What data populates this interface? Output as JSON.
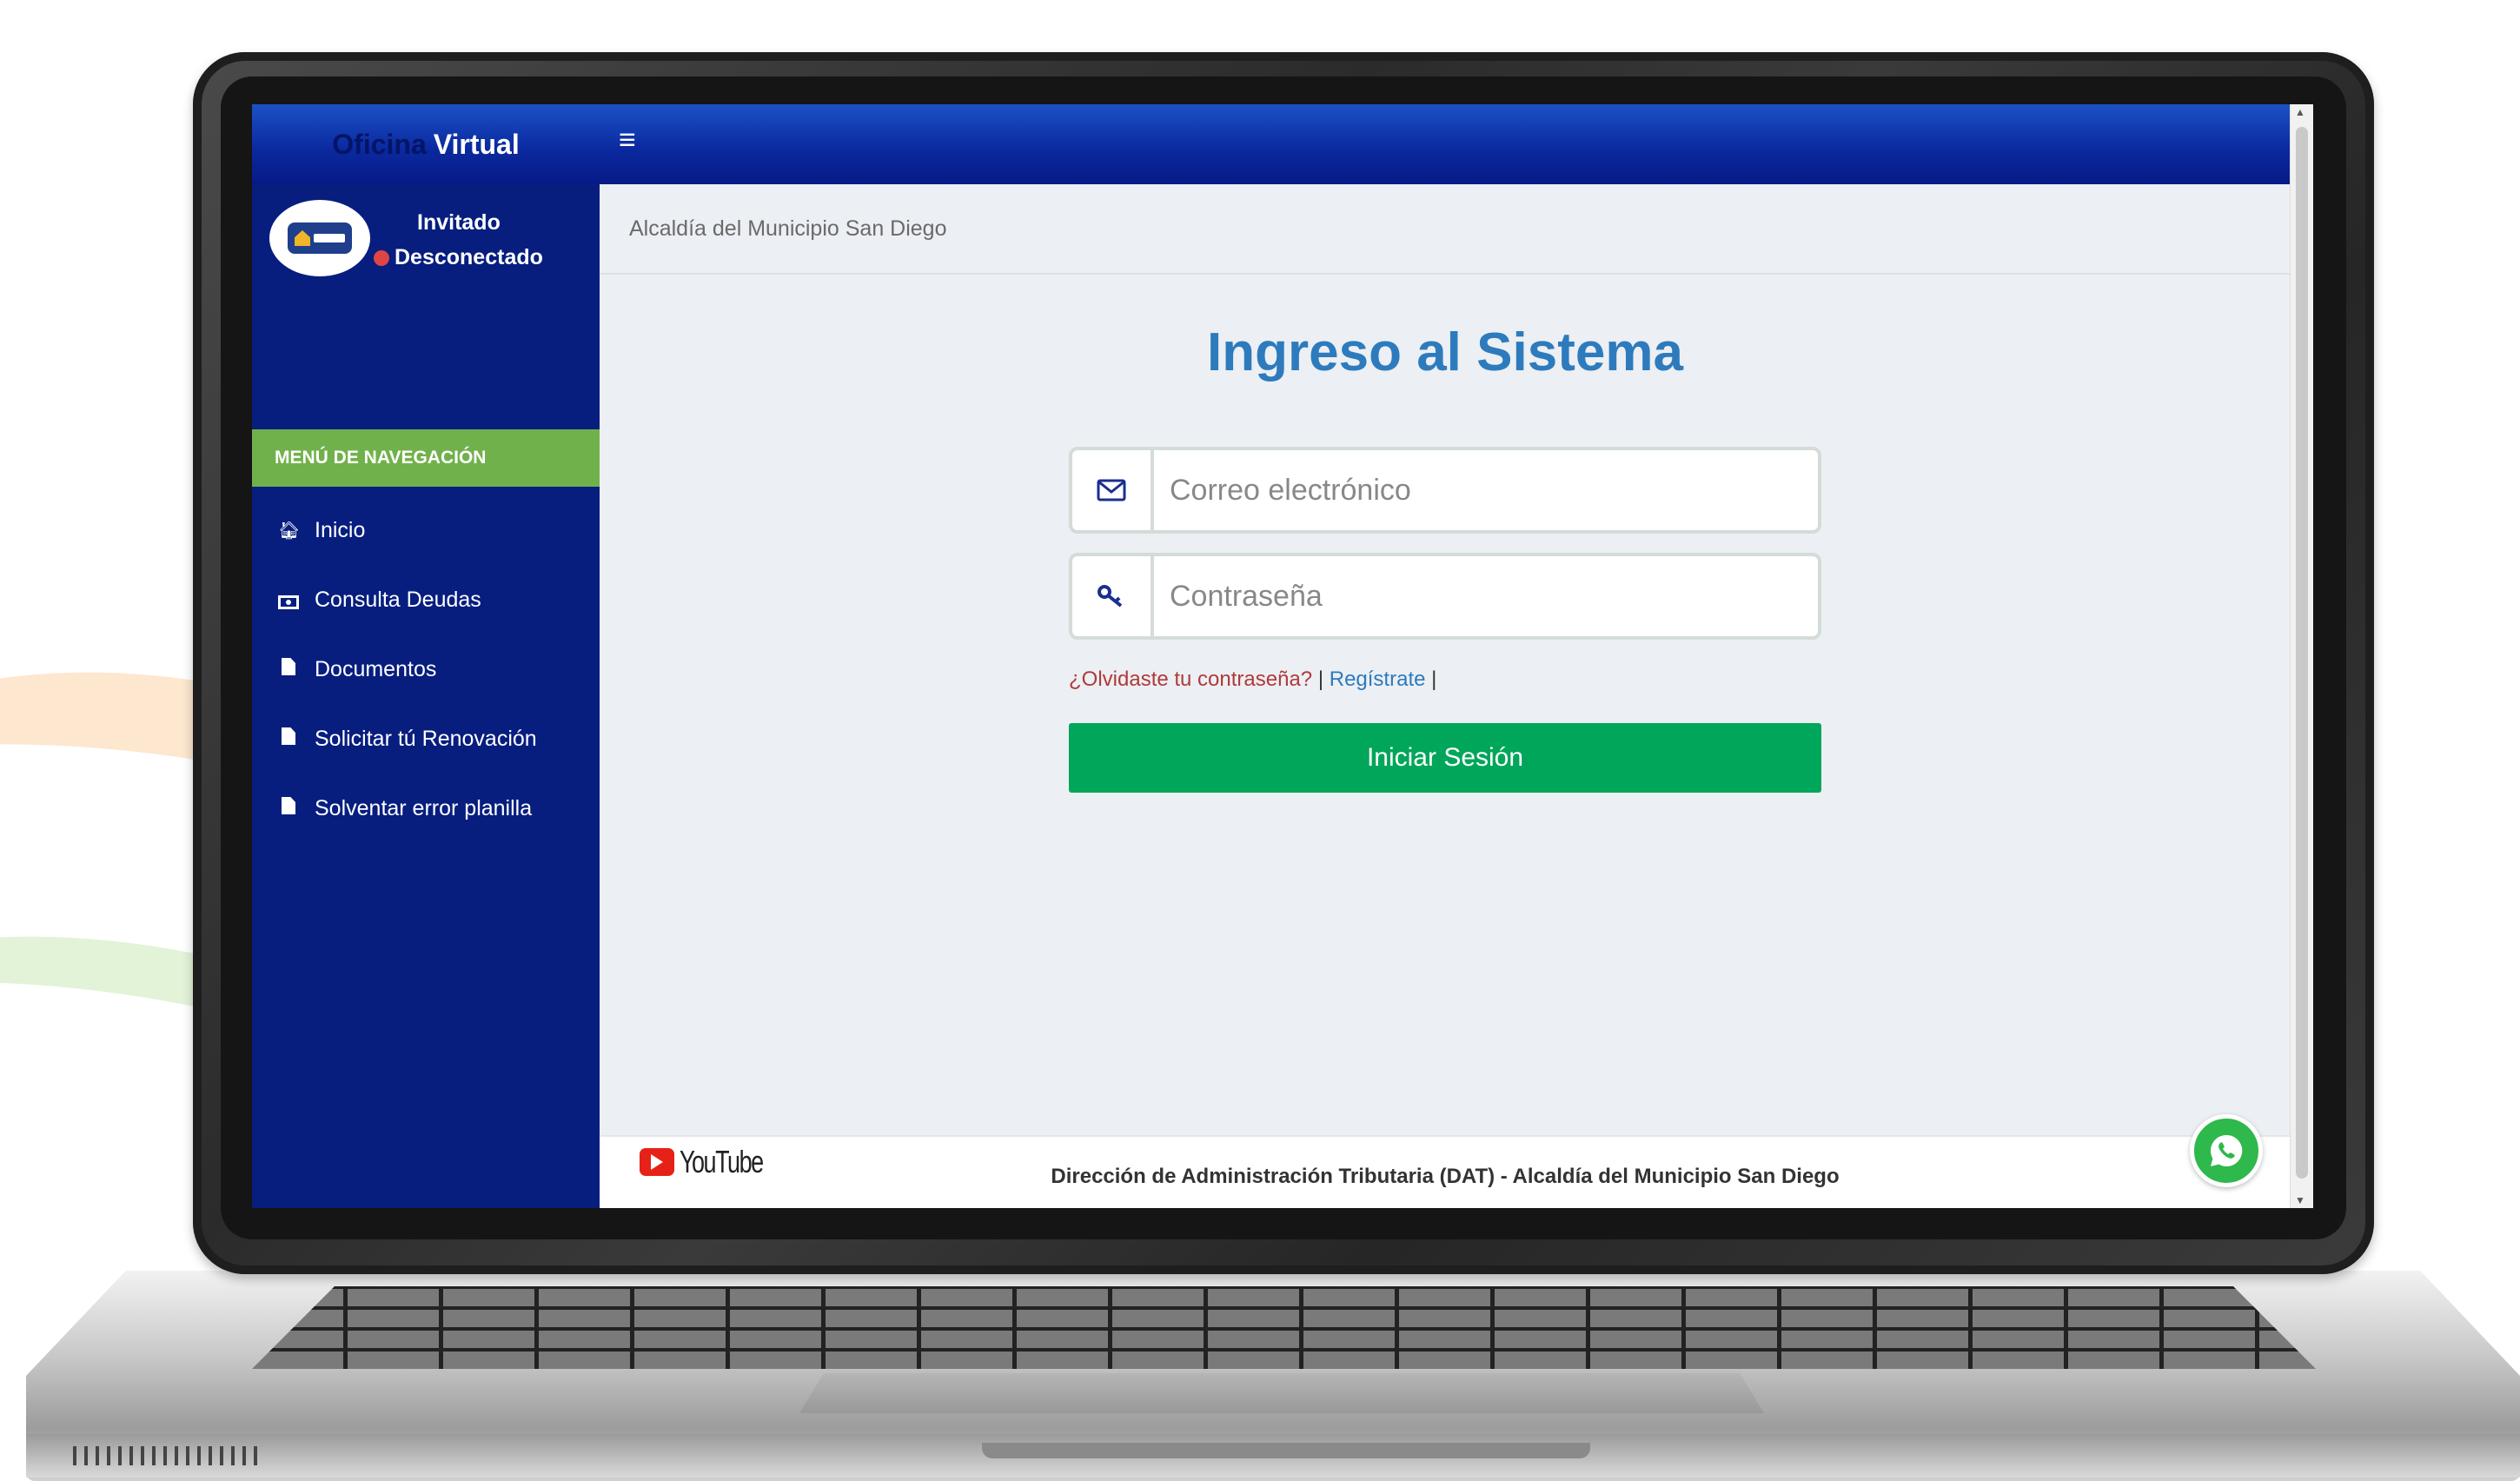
{
  "header": {
    "brand_part1": "Oficina",
    "brand_part2": "Virtual",
    "menu_icon": "hamburger-icon"
  },
  "user": {
    "name": "Invitado",
    "status": "Desconectado",
    "status_color": "#e04545",
    "avatar_logo": "san-diego-logo"
  },
  "sidebar": {
    "header": "MENÚ DE NAVEGACIÓN",
    "header_color": "#71b14b",
    "background_color": "#071e7f",
    "items": [
      {
        "label": "Inicio",
        "icon": "home-icon"
      },
      {
        "label": "Consulta Deudas",
        "icon": "money-icon"
      },
      {
        "label": "Documentos",
        "icon": "file-icon"
      },
      {
        "label": "Solicitar tú Renovación",
        "icon": "file-icon"
      },
      {
        "label": "Solventar error planilla",
        "icon": "file-icon"
      }
    ]
  },
  "breadcrumb": "Alcaldía del Municipio San Diego",
  "login": {
    "title": "Ingreso al Sistema",
    "email_placeholder": "Correo electrónico",
    "password_placeholder": "Contraseña",
    "forgot_link": "¿Olvidaste tu contraseña?",
    "separator": "|",
    "register_link": "Regístrate",
    "trailing_separator": "|",
    "submit_label": "Iniciar Sesión",
    "submit_color": "#00a65a",
    "title_color": "#2d7bbd"
  },
  "footer": {
    "text": "Dirección de Administración Tributaria (DAT) - Alcaldía del Municipio San Diego",
    "youtube_label": "YouTube",
    "whatsapp_icon": "whatsapp-icon"
  }
}
